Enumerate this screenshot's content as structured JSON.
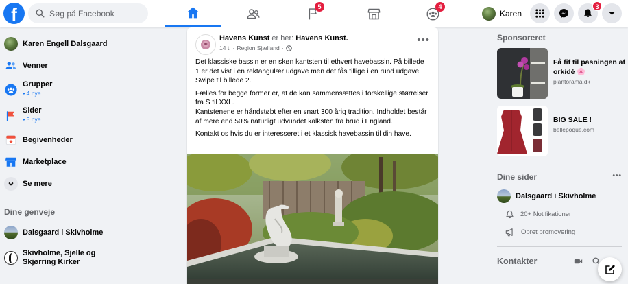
{
  "header": {
    "logo_letter": "f",
    "search_placeholder": "Søg på Facebook",
    "nav_badges": {
      "pages": "5",
      "groups": "4"
    },
    "profile_name": "Karen",
    "notifications_count": "3"
  },
  "sidebar": {
    "profile_name": "Karen Engell Dalsgaard",
    "items": [
      {
        "label": "Venner"
      },
      {
        "label": "Grupper",
        "sub": "4 nye"
      },
      {
        "label": "Sider",
        "sub": "5 nye"
      },
      {
        "label": "Begivenheder"
      },
      {
        "label": "Marketplace"
      },
      {
        "label": "Se mere"
      }
    ],
    "shortcuts_heading": "Dine genveje",
    "shortcuts": [
      {
        "label": "Dalsgaard i Skivholme"
      },
      {
        "label": "Skivholme, Sjelle og Skjørring Kirker"
      }
    ]
  },
  "post": {
    "author": "Havens Kunst",
    "is_here": " er her: ",
    "location_name": "Havens Kunst.",
    "time": "14 t.",
    "place": "Region Sjælland",
    "paragraphs": [
      "Det klassiske bassin er en skøn kantsten til ethvert havebassin. På billede 1 er det vist i en rektangulær udgave men det fås tillige i en rund udgave Swipe til billede 2.",
      "Fælles for begge former er, at de kan sammensættes i forskellige størrelser fra S til XXL.",
      "Kantstenene er håndstøbt efter en snart 300 årig tradition. Indholdet består af mere end 50% naturligt udvundet kalksten fra brud i England.",
      "Kontakt os hvis du er interesseret i et klassisk havebassin til din have."
    ]
  },
  "right": {
    "sponsored_heading": "Sponsoreret",
    "ads": [
      {
        "title": "Få fif til pasningen af orkidé 🌸",
        "url": "plantorama.dk"
      },
      {
        "title": "BIG SALE !",
        "url": "bellepoque.com"
      }
    ],
    "pages_heading": "Dine sider",
    "page_name": "Dalsgaard i Skivholme",
    "page_notifications": "20+ Notifikationer",
    "page_promote": "Opret promovering",
    "contacts_heading": "Kontakter"
  },
  "colors": {
    "brand": "#1877f2",
    "badge": "#e41e3f",
    "background": "#f0f2f5"
  }
}
